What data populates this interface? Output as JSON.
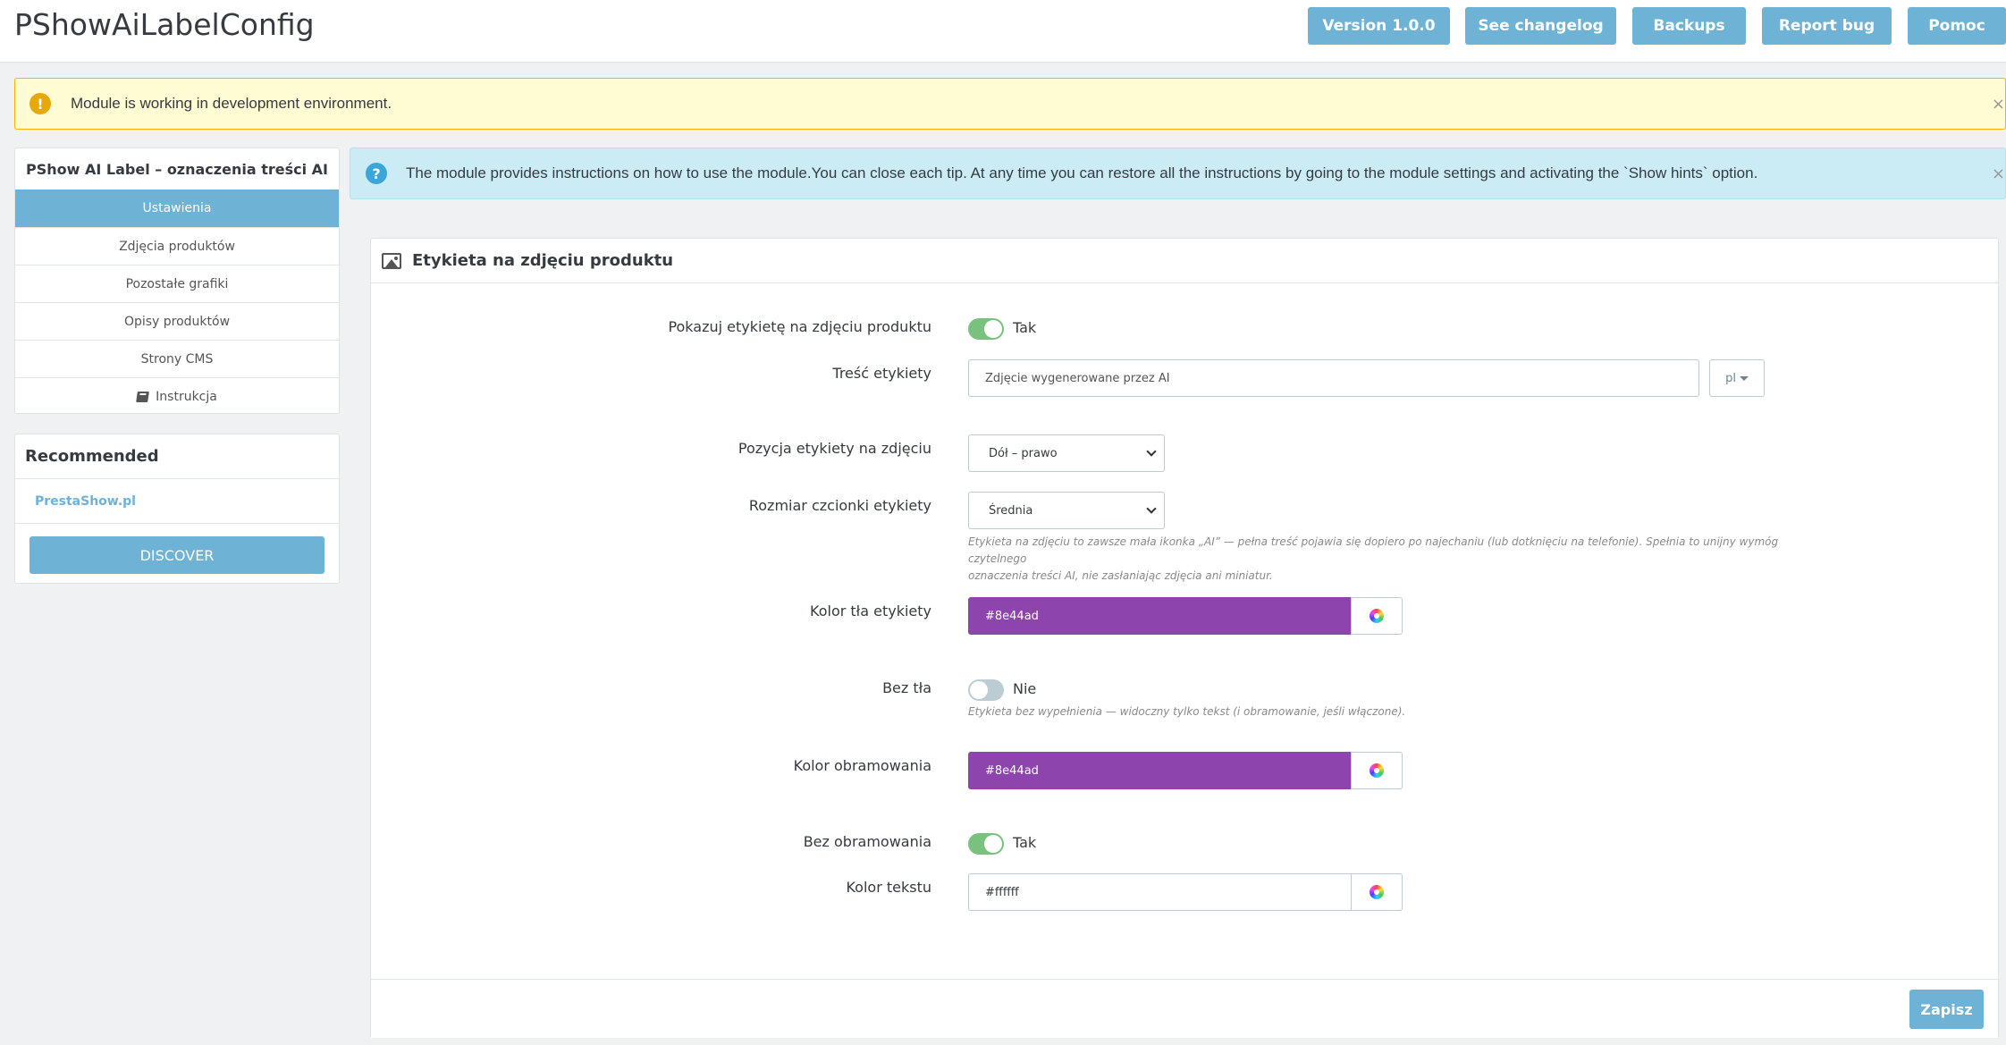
{
  "header": {
    "title": "PShowAiLabelConfig",
    "buttons": {
      "version": "Version 1.0.0",
      "changelog": "See changelog",
      "backups": "Backups",
      "report_bug": "Report bug",
      "help": "Pomoc"
    }
  },
  "alerts": {
    "warning": {
      "text": "Module is working in development environment.",
      "close": "×"
    },
    "info": {
      "text": "The module provides instructions on how to use the module.You can close each tip. At any time you can restore all the instructions by going to the module settings and activating the `Show hints` option.",
      "close": "×"
    }
  },
  "sidebar": {
    "heading": "PShow AI Label – oznaczenia treści AI",
    "items": [
      {
        "label": "Ustawienia",
        "active": true
      },
      {
        "label": "Zdjęcia produktów"
      },
      {
        "label": "Pozostałe grafiki"
      },
      {
        "label": "Opisy produktów"
      },
      {
        "label": "Strony CMS"
      },
      {
        "label": "Instrukcja",
        "icon": "book-icon"
      }
    ]
  },
  "recommended": {
    "heading": "Recommended",
    "link": "PrestaShow.pl",
    "button": "DISCOVER"
  },
  "panel": {
    "title": "Etykieta na zdjęciu produktu",
    "icon": "image-icon",
    "fields": {
      "show_label": {
        "label": "Pokazuj etykietę na zdjęciu produktu",
        "value": "Tak",
        "on": true
      },
      "label_text": {
        "label": "Treść etykiety",
        "value": "Zdjęcie wygenerowane przez AI",
        "lang": "pl"
      },
      "position": {
        "label": "Pozycja etykiety na zdjęciu",
        "value": "Dół – prawo"
      },
      "font_size": {
        "label": "Rozmiar czcionki etykiety",
        "value": "Średnia",
        "help_line1": "Etykieta na zdjęciu to zawsze mała ikonka „AI” — pełna treść pojawia się dopiero po najechaniu (lub dotknięciu na telefonie). Spełnia to unijny wymóg czytelnego",
        "help_line2": "oznaczenia treści AI, nie zasłaniając zdjęcia ani miniatur."
      },
      "bg_color": {
        "label": "Kolor tła etykiety",
        "value": "#8e44ad"
      },
      "no_bg": {
        "label": "Bez tła",
        "value": "Nie",
        "on": false,
        "help": "Etykieta bez wypełnienia — widoczny tylko tekst (i obramowanie, jeśli włączone)."
      },
      "border_color": {
        "label": "Kolor obramowania",
        "value": "#8e44ad"
      },
      "no_border": {
        "label": "Bez obramowania",
        "value": "Tak",
        "on": true
      },
      "text_color": {
        "label": "Kolor tekstu",
        "value": "#ffffff"
      }
    },
    "save": "Zapisz"
  },
  "colors": {
    "accent": "#6eb3d6",
    "label_bg": "#8e44ad",
    "switch_on": "#78c27e"
  }
}
